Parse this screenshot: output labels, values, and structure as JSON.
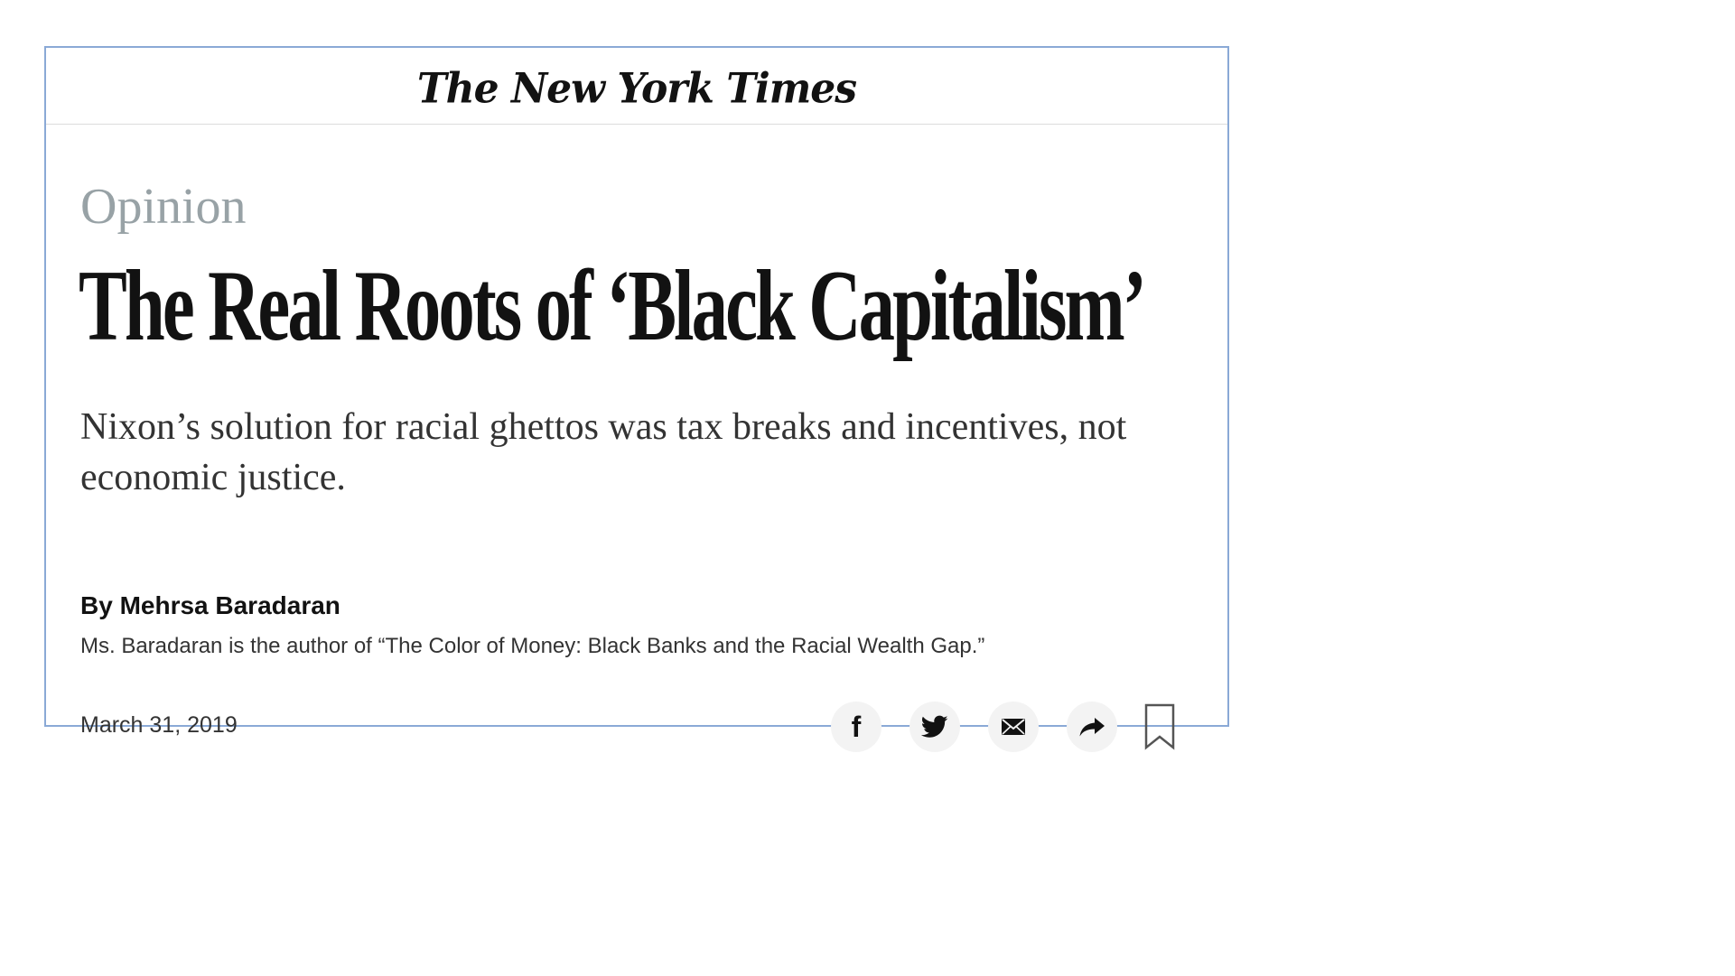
{
  "masthead": {
    "logo_text": "The New York Times"
  },
  "article": {
    "kicker": "Opinion",
    "headline": "The Real Roots of ‘Black Capitalism’",
    "dek": "Nixon’s solution for racial ghettos was tax breaks and incentives, not economic justice.",
    "byline": "By Mehrsa Baradaran",
    "author_bio": "Ms. Baradaran is the author of “The Color of Money: Black Banks and the Racial Wealth Gap.”",
    "date": "March 31, 2019"
  },
  "share_tools": {
    "facebook_glyph": "f",
    "icons": [
      "facebook-icon",
      "twitter-icon",
      "email-icon",
      "share-arrow-icon",
      "bookmark-icon"
    ]
  },
  "colors": {
    "card_border": "#8aa9d6",
    "kicker": "#98a2a6",
    "headline": "#121212",
    "share_button_bg": "#f3f3f3"
  }
}
